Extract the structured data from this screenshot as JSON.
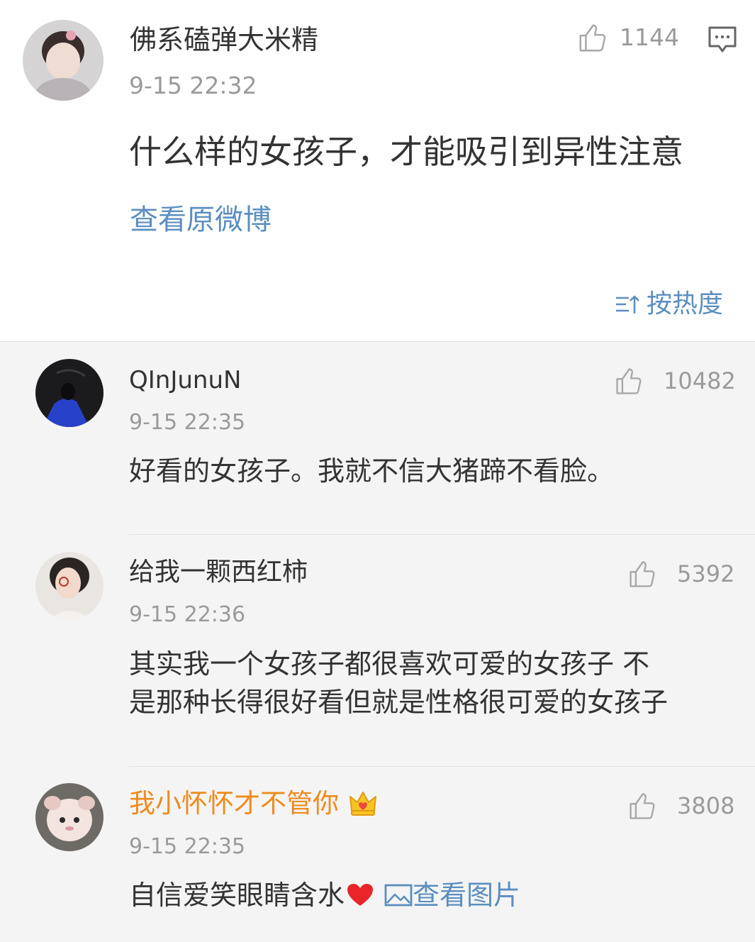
{
  "post": {
    "username": "佛系磕弹大米精",
    "time": "9-15 22:32",
    "likes": "1144",
    "content": "什么样的女孩子，才能吸引到异性注意",
    "view_original": "查看原微博",
    "sort_label": "按热度",
    "accent_color": "#5b8ec0"
  },
  "comments": [
    {
      "username": "QInJunuN",
      "time": "9-15 22:35",
      "likes": "10482",
      "content_lines": [
        "好看的女孩子。我就不信大猪蹄不看脸。"
      ]
    },
    {
      "username": "给我一颗西红柿",
      "time": "9-15 22:36",
      "likes": "5392",
      "content_lines": [
        "其实我一个女孩子都很喜欢可爱的女孩子 不",
        "是那种长得很好看但就是性格很可爱的女孩子"
      ]
    },
    {
      "username": "我小怀怀才不管你",
      "username_color": "#f08a1d",
      "time": "9-15 22:35",
      "likes": "3808",
      "content": "自信爱笑眼睛含水",
      "view_image": "查看图片"
    }
  ]
}
